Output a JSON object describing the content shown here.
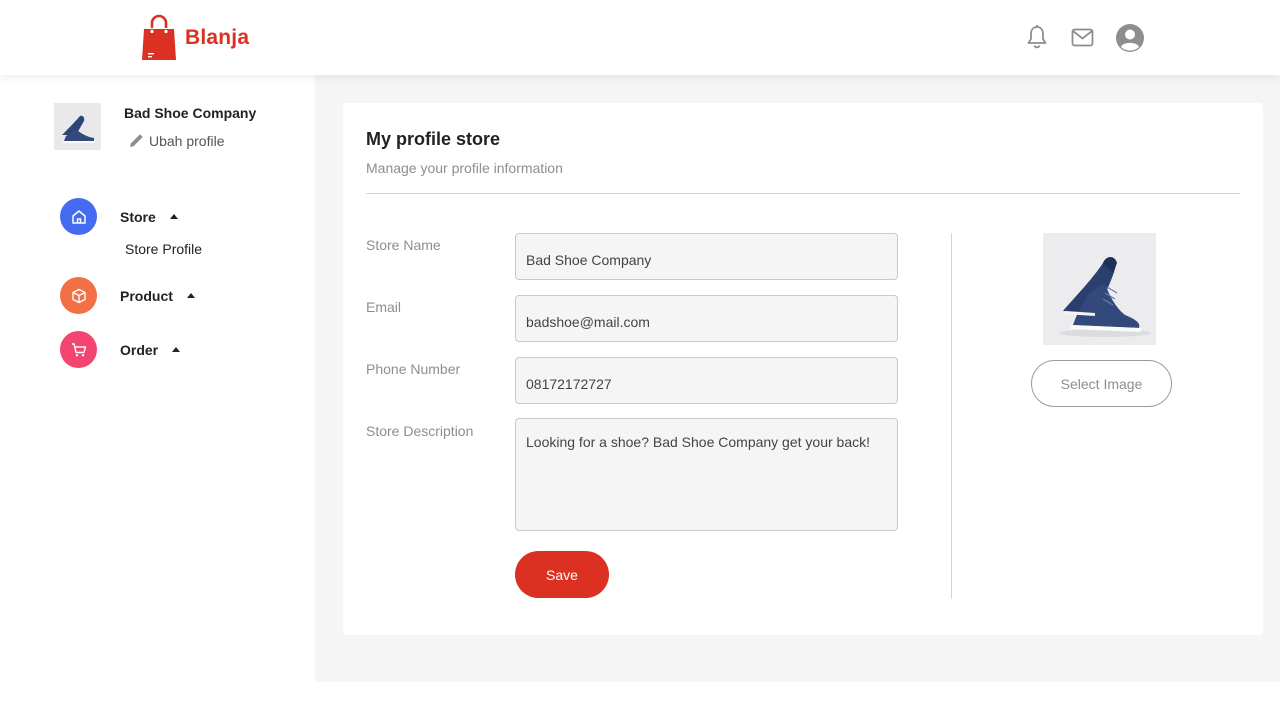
{
  "header": {
    "brand": "Blanja",
    "brand_color": "#db3022",
    "icons": [
      "bell-icon",
      "mail-icon",
      "user-circle-icon"
    ]
  },
  "sidebar": {
    "shop_name": "Bad Shoe Company",
    "edit_label": "Ubah profile",
    "nav": [
      {
        "label": "Store",
        "icon": "home-icon",
        "color": "#456bf3",
        "sub_items": [
          "Store Profile"
        ]
      },
      {
        "label": "Product",
        "icon": "package-icon",
        "color": "#f36f45"
      },
      {
        "label": "Order",
        "icon": "cart-icon",
        "color": "#f3456f"
      }
    ]
  },
  "main": {
    "title": "My profile store",
    "subtitle": "Manage your profile information",
    "fields": {
      "store_name": {
        "label": "Store Name",
        "value": "Bad Shoe Company"
      },
      "email": {
        "label": "Email",
        "value": "badshoe@mail.com"
      },
      "phone": {
        "label": "Phone Number",
        "value": "08172172727"
      },
      "description": {
        "label": "Store Description",
        "value": "Looking for a shoe? Bad Shoe Company get your back!"
      }
    },
    "save_label": "Save",
    "select_image_label": "Select Image"
  }
}
